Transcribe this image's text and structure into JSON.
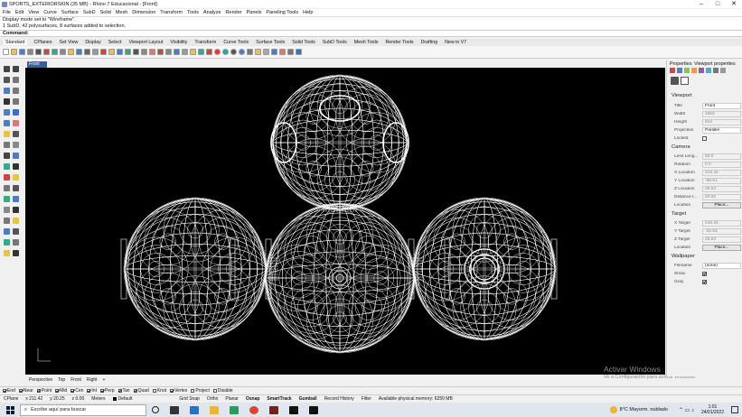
{
  "window": {
    "title": "SPORTS_EXTERIORSKIN (35 MB) - Rhino 7 Educacional - [Front]",
    "controls": [
      "–",
      "□",
      "✕"
    ]
  },
  "menu": [
    "File",
    "Edit",
    "View",
    "Curve",
    "Surface",
    "SubD",
    "Solid",
    "Mesh",
    "Dimension",
    "Transform",
    "Tools",
    "Analyze",
    "Render",
    "Panels",
    "Paneling Tools",
    "Help"
  ],
  "command_history": [
    "Display mode set to \"Wireframe\".",
    "1 SubD, 42 polysurfaces, 8 surfaces added to selection."
  ],
  "command_prompt": "Command:",
  "toolbar_tabs": [
    "Standard",
    "CPlanes",
    "Set View",
    "Display",
    "Select",
    "Viewport Layout",
    "Visibility",
    "Transform",
    "Curve Tools",
    "Surface Tools",
    "Solid Tools",
    "SubD Tools",
    "Mesh Tools",
    "Render Tools",
    "Drafting",
    "New in V7"
  ],
  "viewport": {
    "active_tab": "Front",
    "tabs": [
      "Perspective",
      "Top",
      "Front",
      "Right",
      "+"
    ]
  },
  "watermark": {
    "title": "Activar Windows",
    "subtitle": "Ve a Configuración para activar Windows."
  },
  "osnaps": [
    {
      "label": "End",
      "on": true
    },
    {
      "label": "Near",
      "on": true
    },
    {
      "label": "Point",
      "on": true
    },
    {
      "label": "Mid",
      "on": true
    },
    {
      "label": "Cen",
      "on": true
    },
    {
      "label": "Int",
      "on": true
    },
    {
      "label": "Perp",
      "on": true
    },
    {
      "label": "Tan",
      "on": true
    },
    {
      "label": "Quad",
      "on": true
    },
    {
      "label": "Knot",
      "on": false
    },
    {
      "label": "Vertex",
      "on": true
    },
    {
      "label": "Project",
      "on": false
    },
    {
      "label": "Disable",
      "on": false
    }
  ],
  "status": {
    "cplane": "CPlane",
    "x": "x 211.42",
    "y": "y 20.25",
    "z": "z 0.00",
    "units": "Meters",
    "layer": "Default",
    "toggles": [
      "Grid Snap",
      "Ortho",
      "Planar",
      "Osnap",
      "SmartTrack",
      "Gumball",
      "Record History",
      "Filter"
    ],
    "bold_toggles": [
      "Osnap",
      "SmartTrack",
      "Gumball"
    ],
    "memory": "Available physical memory: 6250 MB"
  },
  "properties": {
    "panel_title": "Properties: Viewport properties",
    "viewport_section": "Viewport",
    "title_label": "Title",
    "title_value": "Front",
    "width_label": "Width",
    "width_value": "1654",
    "height_label": "Height",
    "height_value": "812",
    "projection_label": "Projection",
    "projection_value": "Parallel",
    "locked_label": "Locked",
    "camera_section": "Camera",
    "lens_label": "Lens Leng...",
    "lens_value": "50.0",
    "rotation_label": "Rotation",
    "rotation_value": "0.0",
    "xloc_label": "X Location",
    "xloc_value": "215.44",
    "yloc_label": "Y Location",
    "yloc_value": "-58.61",
    "zloc_label": "Z Location",
    "zloc_value": "28.52",
    "dist_label": "Distance t...",
    "dist_value": "20.50",
    "location_label": "Location",
    "place_button": "Place...",
    "target_section": "Target",
    "xtgt_label": "X Target",
    "xtgt_value": "215.44",
    "ytgt_label": "Y Target",
    "ytgt_value": "-32.53",
    "ztgt_label": "Z Target",
    "ztgt_value": "28.52",
    "tloc_label": "Location",
    "tplace_button": "Place...",
    "wallpaper_section": "Wallpaper",
    "filename_label": "Filename",
    "filename_value": "(none)",
    "show_label": "Show",
    "gray_label": "Gray"
  },
  "taskbar": {
    "search_placeholder": "Escribe aquí para buscar",
    "weather": "8°C  Mayorm. nublado",
    "time": "1:01",
    "date": "24/01/2022"
  },
  "colors": {
    "viewport_bg": "#000000",
    "wireframe": "#ffffff",
    "active_tab": "#3a5f99"
  }
}
